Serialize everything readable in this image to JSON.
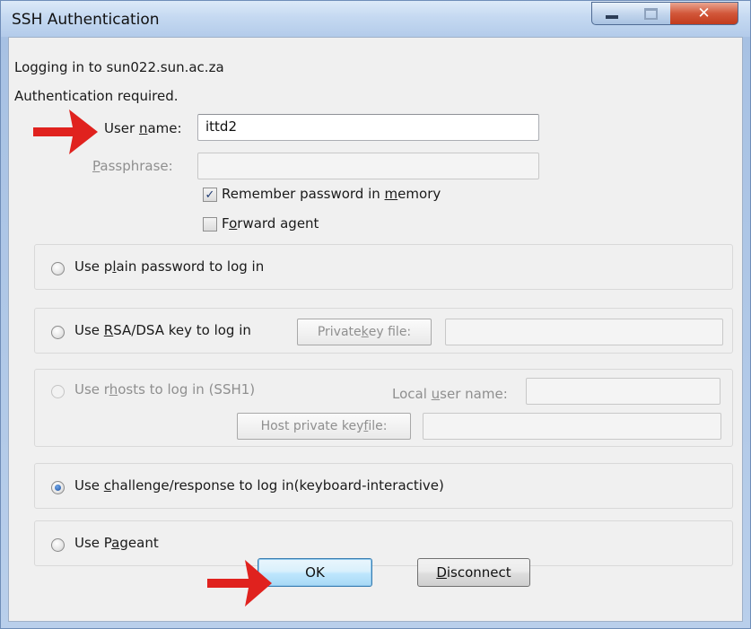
{
  "window": {
    "title": "SSH Authentication"
  },
  "info": {
    "logging_in": "Logging in to sun022.sun.ac.za",
    "auth_required": "Authentication required."
  },
  "username": {
    "label_pre": "User ",
    "label_access": "n",
    "label_post": "ame:",
    "value": "ittd2"
  },
  "passphrase": {
    "label_access": "P",
    "label_post": "assphrase:",
    "value": ""
  },
  "remember_password": {
    "label_pre": "Remember password in ",
    "label_access": "m",
    "label_post": "emory",
    "checked": true
  },
  "forward_agent": {
    "label_pre": "F",
    "label_access": "o",
    "label_post": "rward agent",
    "checked": false
  },
  "methods": {
    "plain": {
      "pre": "Use p",
      "access": "l",
      "post": "ain password to log in",
      "selected": false
    },
    "rsa": {
      "pre": "Use ",
      "access": "R",
      "post": "SA/DSA key to log in",
      "selected": false,
      "key_button_pre": "Private ",
      "key_button_access": "k",
      "key_button_post": "ey file:"
    },
    "rhosts": {
      "pre": "Use r",
      "access": "h",
      "post": "osts to log in (SSH1)",
      "selected": false,
      "enabled": false,
      "local_user_pre": "Local ",
      "local_user_access": "u",
      "local_user_post": "ser name:",
      "host_key_pre": "Host private key ",
      "host_key_access": "f",
      "host_key_post": "ile:"
    },
    "challenge": {
      "pre": "Use ",
      "access": "c",
      "post": "hallenge/response to log in(keyboard-interactive)",
      "selected": true
    },
    "pageant": {
      "pre": "Use P",
      "access": "a",
      "post": "geant",
      "selected": false
    }
  },
  "buttons": {
    "ok": "OK",
    "disconnect_access": "D",
    "disconnect_post": "isconnect"
  },
  "colors": {
    "arrow": "#e0221e",
    "title_close": "#c94a2c",
    "ok_border": "#3c7fb1"
  },
  "icons": {
    "minimize": "minimize-icon",
    "maximize": "maximize-icon",
    "close": "close-icon",
    "arrow": "red-arrow-annotation"
  }
}
